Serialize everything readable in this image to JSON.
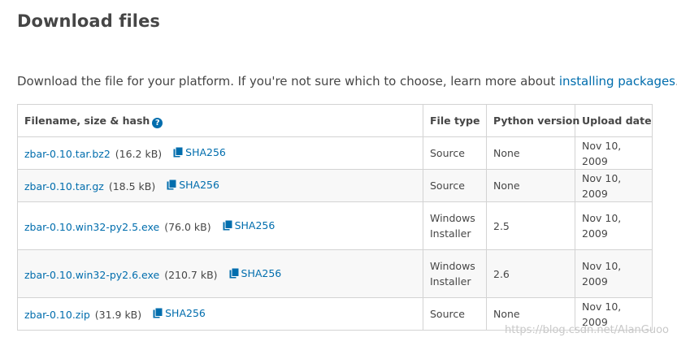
{
  "heading": "Download files",
  "intro": {
    "text": "Download the file for your platform. If you're not sure which to choose, learn more about ",
    "link": "installing packages",
    "suffix": "."
  },
  "table": {
    "headers": {
      "filename": "Filename, size & hash",
      "file_type": "File type",
      "python_version": "Python version",
      "upload_date": "Upload date"
    },
    "rows": [
      {
        "filename": "zbar-0.10.tar.bz2",
        "size": "(16.2 kB)",
        "hash": "SHA256",
        "file_type": "Source",
        "python_version": "None",
        "upload_date": "Nov 10, 2009"
      },
      {
        "filename": "zbar-0.10.tar.gz",
        "size": "(18.5 kB)",
        "hash": "SHA256",
        "file_type": "Source",
        "python_version": "None",
        "upload_date": "Nov 10, 2009"
      },
      {
        "filename": "zbar-0.10.win32-py2.5.exe",
        "size": "(76.0 kB)",
        "hash": "SHA256",
        "file_type": "Windows Installer",
        "python_version": "2.5",
        "upload_date": "Nov 10, 2009"
      },
      {
        "filename": "zbar-0.10.win32-py2.6.exe",
        "size": "(210.7 kB)",
        "hash": "SHA256",
        "file_type": "Windows Installer",
        "python_version": "2.6",
        "upload_date": "Nov 10, 2009"
      },
      {
        "filename": "zbar-0.10.zip",
        "size": "(31.9 kB)",
        "hash": "SHA256",
        "file_type": "Source",
        "python_version": "None",
        "upload_date": "Nov 10, 2009"
      }
    ]
  },
  "watermark": "https://blog.csdn.net/AlanGuoo",
  "colors": {
    "link": "#006dad",
    "text": "#464646",
    "border": "#d3d3d3"
  },
  "icons": {
    "hash": "copy-icon",
    "help": "question-circle-icon"
  }
}
